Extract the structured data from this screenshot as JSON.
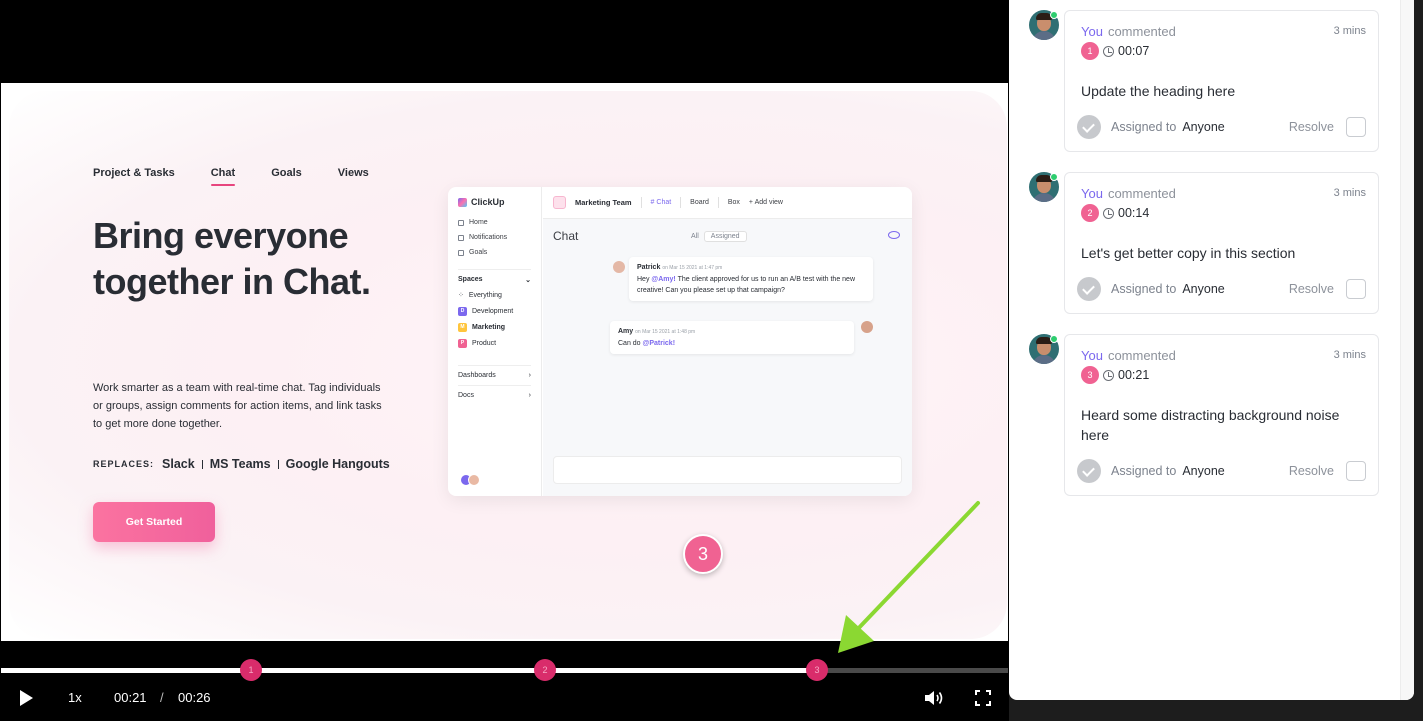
{
  "landing": {
    "nav": [
      "Project & Tasks",
      "Chat",
      "Goals",
      "Views"
    ],
    "heading": "Bring everyone together in Chat.",
    "description": "Work smarter as a team with real-time chat. Tag individuals or groups, assign comments for action items, and link tasks to get more done together.",
    "replaces_label": "REPLACES:",
    "replaces": [
      "Slack",
      "MS Teams",
      "Google Hangouts"
    ],
    "cta": "Get Started"
  },
  "mock_app": {
    "logo": "ClickUp",
    "nav": [
      "Home",
      "Notifications",
      "Goals"
    ],
    "spaces_label": "Spaces",
    "everything": "Everything",
    "spaces": [
      {
        "badge": "D",
        "name": "Development",
        "color": "#7b68ee"
      },
      {
        "badge": "M",
        "name": "Marketing",
        "color": "#ffc53d"
      },
      {
        "badge": "P",
        "name": "Product",
        "color": "#f06292"
      }
    ],
    "dashboards": "Dashboards",
    "docs": "Docs",
    "team": "Marketing Team",
    "tabs": [
      "# Chat",
      "Board",
      "Box",
      "+ Add view"
    ],
    "title": "Chat",
    "filter_all": "All",
    "filter_assigned": "Assigned",
    "messages": [
      {
        "who": "Patrick",
        "when": "on Mar 15 2021 at 1:47 pm",
        "pre": "Hey ",
        "mention": "@Amy!",
        "post": " The client approved for us to run an A/B test with the new creative! Can you please set up that campaign?"
      },
      {
        "who": "Amy",
        "when": "on Mar 15 2021 at 1:48 pm",
        "pre": "Can do ",
        "mention": "@Patrick!",
        "post": ""
      }
    ]
  },
  "video": {
    "active_comment": "3",
    "markers": [
      "1",
      "2",
      "3"
    ],
    "speed": "1x",
    "current_time": "00:21",
    "separator": "/",
    "duration": "00:26",
    "progress": 0.81
  },
  "comments": [
    {
      "user": "You",
      "verb": "commented",
      "ago": "3 mins",
      "num": "1",
      "timestamp": "00:07",
      "text": "Update the heading here",
      "assigned_label": "Assigned to",
      "assignee": "Anyone",
      "resolve": "Resolve"
    },
    {
      "user": "You",
      "verb": "commented",
      "ago": "3 mins",
      "num": "2",
      "timestamp": "00:14",
      "text": "Let's get better copy in this section",
      "assigned_label": "Assigned to",
      "assignee": "Anyone",
      "resolve": "Resolve"
    },
    {
      "user": "You",
      "verb": "commented",
      "ago": "3 mins",
      "num": "3",
      "timestamp": "00:21",
      "text": "Heard some distracting background noise here",
      "assigned_label": "Assigned to",
      "assignee": "Anyone",
      "resolve": "Resolve"
    }
  ],
  "colors": {
    "accent": "#7b68ee",
    "marker": "#f06292",
    "annotation_arrow": "#8bd832"
  }
}
